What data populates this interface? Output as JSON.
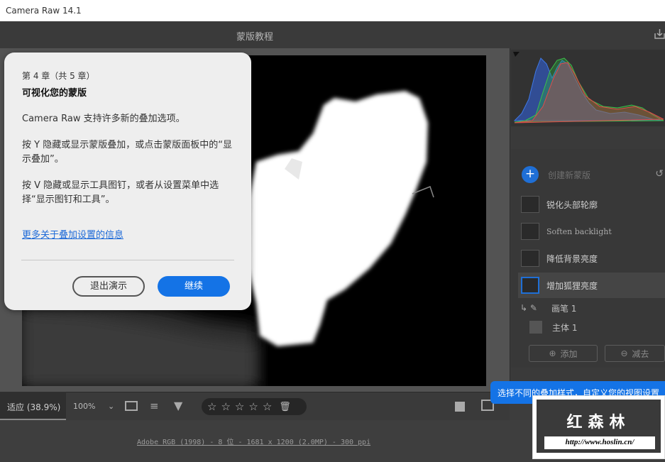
{
  "window": {
    "title": "Camera Raw 14.1"
  },
  "topbar": {
    "title": "蒙版教程"
  },
  "dialog": {
    "chapter": "第 4 章（共 5 章）",
    "title": "可视化您的蒙版",
    "p1": "Camera Raw 支持许多新的叠加选项。",
    "p2": "按 Y 隐藏或显示蒙版叠加，或点击蒙版面板中的“显示叠加”。",
    "p3": "按 V 隐藏或显示工具图钉，或者从设置菜单中选择“显示图钉和工具”。",
    "link": "更多关于叠加设置的信息",
    "exit_label": "退出演示",
    "continue_label": "继续"
  },
  "masks": {
    "create_label": "创建新蒙版",
    "items": [
      {
        "label": "锐化头部轮廓"
      },
      {
        "label": "Soften backlight"
      },
      {
        "label": "降低背景亮度"
      },
      {
        "label": "增加狐狸亮度",
        "selected": true
      }
    ],
    "components": [
      {
        "label": "画笔 1"
      },
      {
        "label": "主体 1"
      }
    ],
    "add_label": "添加",
    "subtract_label": "减去"
  },
  "bottombar": {
    "fit_label": "适应 (38.9%)",
    "zoom_label": "100%",
    "stars": [
      "☆",
      "☆",
      "☆",
      "☆",
      "☆"
    ]
  },
  "footer": {
    "info": "Adobe RGB (1998) - 8 位 - 1681 x 1200 (2.0MP) - 300 ppi"
  },
  "tooltip": {
    "text": "选择不同的叠加样式，自定义您的视图设置"
  },
  "watermark": {
    "title": "红森林",
    "url": "http://www.hoslin.cn/"
  },
  "colors": {
    "accent": "#1473e6",
    "panel": "#3a3a3a",
    "dialog_bg": "#eeeeee"
  }
}
